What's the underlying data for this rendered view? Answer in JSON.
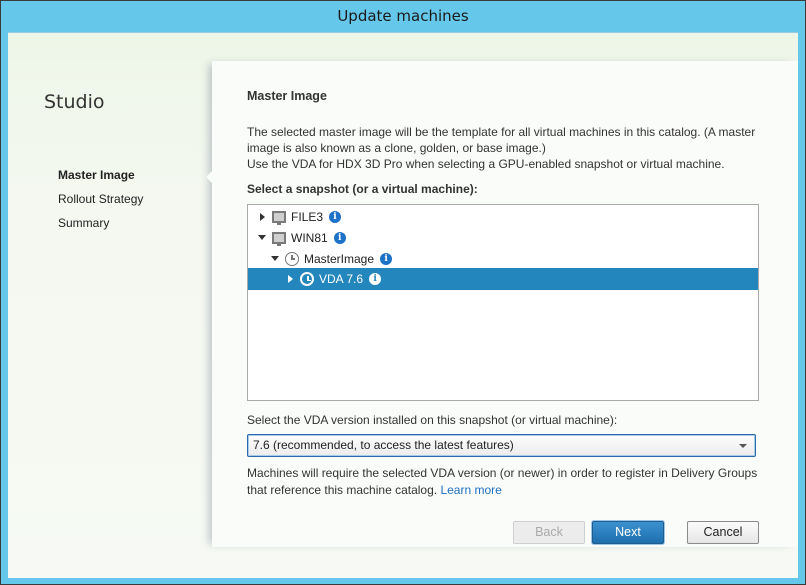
{
  "window": {
    "title": "Update machines",
    "accent_color": "#65c8eb"
  },
  "sidebar": {
    "title": "Studio",
    "steps": [
      {
        "label": "Master Image",
        "active": true
      },
      {
        "label": "Rollout Strategy",
        "active": false
      },
      {
        "label": "Summary",
        "active": false
      }
    ]
  },
  "main": {
    "heading": "Master Image",
    "description_lines": [
      "The selected master image will be the template for all virtual machines in this catalog. (A master image is also known as a clone, golden, or base image.)",
      "Use the VDA for HDX 3D Pro when selecting a GPU-enabled snapshot or virtual machine."
    ],
    "snapshot_label": "Select a snapshot (or a virtual machine):",
    "tree": [
      {
        "label": "FILE3",
        "icon": "monitor-icon",
        "expander": "collapsed",
        "level": 0,
        "selected": false
      },
      {
        "label": "WIN81",
        "icon": "monitor-icon",
        "expander": "expanded",
        "level": 0,
        "selected": false
      },
      {
        "label": "MasterImage",
        "icon": "snapshot-clock-icon",
        "expander": "expanded",
        "level": 1,
        "selected": false
      },
      {
        "label": "VDA 7.6",
        "icon": "snapshot-clock-icon",
        "expander": "collapsed",
        "level": 2,
        "selected": true
      }
    ],
    "vda_label": "Select the VDA version installed on this snapshot (or virtual machine):",
    "vda_selected": "7.6 (recommended, to access the latest features)",
    "note": "Machines will require the selected VDA version (or newer) in order to register in Delivery Groups that reference this machine catalog.",
    "learn_more": "Learn more",
    "selection_color": "#2386bc"
  },
  "buttons": {
    "back": "Back",
    "next": "Next",
    "cancel": "Cancel",
    "back_enabled": false
  }
}
